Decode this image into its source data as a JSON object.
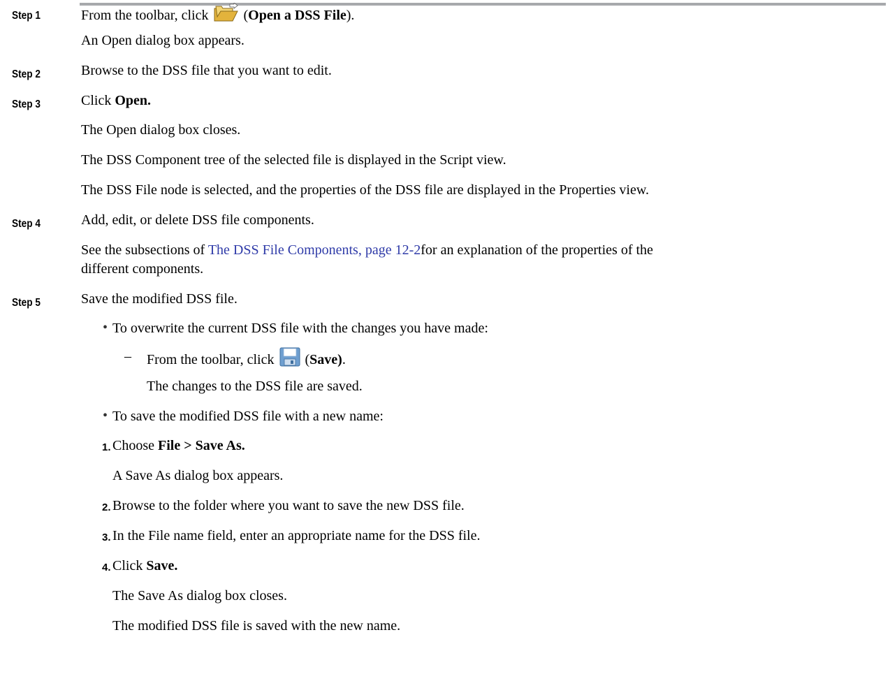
{
  "steps": {
    "step1": {
      "label": "Step 1",
      "text_before": "From the toolbar, click",
      "paren_open": "(",
      "bold": "Open a DSS File",
      "paren_close": ").",
      "icon": "open-folder-icon",
      "result": "An Open dialog box appears."
    },
    "step2": {
      "label": "Step 2",
      "text": "Browse to the DSS file that you want to edit."
    },
    "step3": {
      "label": "Step 3",
      "text_before": "Click",
      "bold": "Open.",
      "result1": "The Open dialog box closes.",
      "result2": "The DSS Component tree of the selected file is displayed in the Script view.",
      "result3": "The DSS File node is selected, and the properties of the DSS file are displayed in the Properties view."
    },
    "step4": {
      "label": "Step 4",
      "text": "Add, edit, or delete DSS file components.",
      "see_before": "See the subsections of",
      "link": "The DSS File Components, page 12-2",
      "see_after": "for an explanation of the properties of the",
      "see_line2": "different components."
    },
    "step5": {
      "label": "Step 5",
      "text": "Save the modified DSS file.",
      "bullet1": "To overwrite the current DSS file with the changes you have made:",
      "sub_before": "From the toolbar, click",
      "sub_paren_open": "(",
      "sub_bold": "Save)",
      "sub_end": ".",
      "sub_icon": "save-disk-icon",
      "sub_result": "The changes to the DSS file are saved.",
      "bullet2": "To save the modified DSS file with a new name:",
      "items": [
        {
          "num": "1.",
          "before": "Choose",
          "bold": "File > Save As.",
          "after": ""
        },
        {
          "num": "2.",
          "before": "Browse to the folder where you want to save the new DSS file.",
          "bold": "",
          "after": ""
        },
        {
          "num": "3.",
          "before": "In the File name field, enter an appropriate name for the DSS file.",
          "bold": "",
          "after": ""
        },
        {
          "num": "4.",
          "before": "Click",
          "bold": "Save.",
          "after": ""
        }
      ],
      "item1_result": "A Save As dialog box appears.",
      "item4_result1": "The Save As dialog box closes.",
      "item4_result2": "The modified DSS file is saved with the new name."
    }
  },
  "symbols": {
    "bullet": "•",
    "dash": "–"
  },
  "colors": {
    "link": "#2f3ba8",
    "rule": "#a7a9ac"
  }
}
